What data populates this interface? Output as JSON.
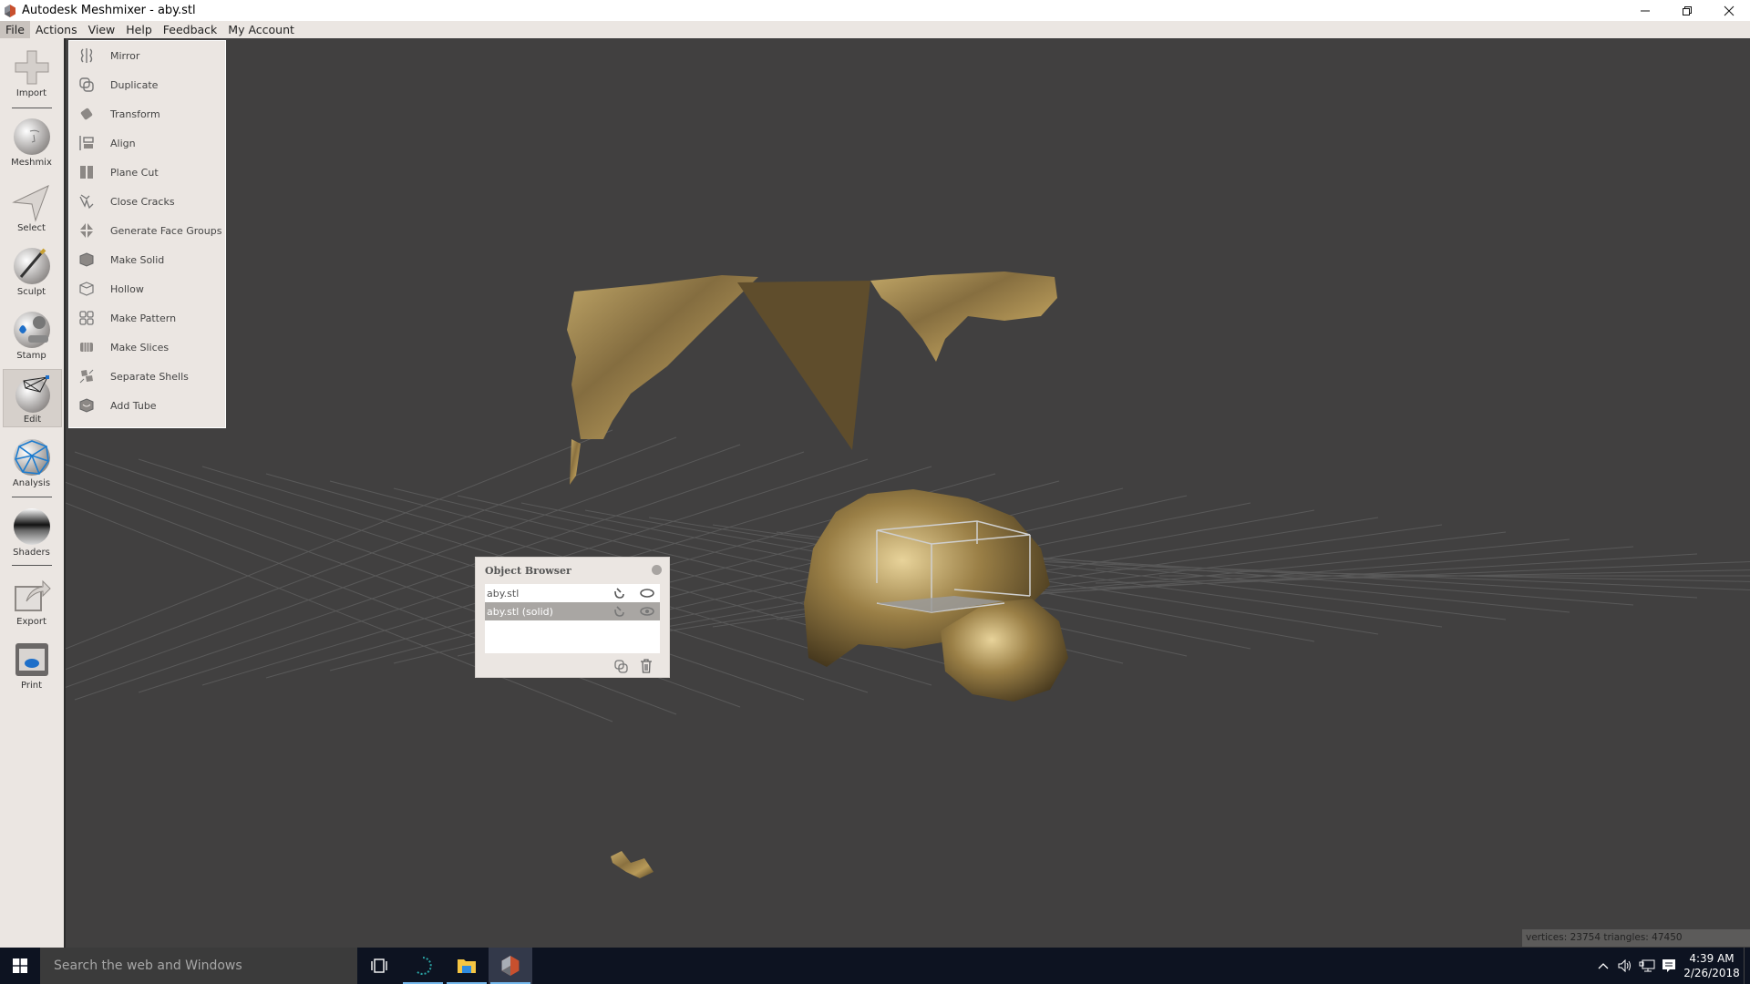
{
  "window": {
    "title": "Autodesk Meshmixer - aby.stl",
    "controls": {
      "minimize": "minimize-icon",
      "restore": "restore-icon",
      "close": "close-icon"
    }
  },
  "menubar": {
    "items": [
      {
        "label": "File",
        "active": true
      },
      {
        "label": "Actions"
      },
      {
        "label": "View"
      },
      {
        "label": "Help"
      },
      {
        "label": "Feedback"
      },
      {
        "label": "My Account"
      }
    ]
  },
  "sidebar": {
    "tools": [
      {
        "label": "Import",
        "icon": "plus-icon"
      },
      {
        "label": "Meshmix",
        "icon": "face-sphere-icon"
      },
      {
        "label": "Select",
        "icon": "arrow-cursor-icon"
      },
      {
        "label": "Sculpt",
        "icon": "brush-sphere-icon"
      },
      {
        "label": "Stamp",
        "icon": "stamp-icon"
      },
      {
        "label": "Edit",
        "icon": "mesh-sphere-icon",
        "active": true
      },
      {
        "label": "Analysis",
        "icon": "analysis-mesh-icon"
      },
      {
        "label": "Shaders",
        "icon": "chrome-sphere-icon"
      },
      {
        "label": "Export",
        "icon": "export-icon"
      },
      {
        "label": "Print",
        "icon": "printer-icon"
      }
    ]
  },
  "edit_menu": {
    "items": [
      {
        "label": "Mirror",
        "icon": "mirror-icon"
      },
      {
        "label": "Duplicate",
        "icon": "duplicate-icon"
      },
      {
        "label": "Transform",
        "icon": "transform-icon"
      },
      {
        "label": "Align",
        "icon": "align-icon"
      },
      {
        "label": "Plane Cut",
        "icon": "plane-cut-icon"
      },
      {
        "label": "Close Cracks",
        "icon": "close-cracks-icon"
      },
      {
        "label": "Generate Face Groups",
        "icon": "face-groups-icon"
      },
      {
        "label": "Make Solid",
        "icon": "make-solid-icon"
      },
      {
        "label": "Hollow",
        "icon": "hollow-icon"
      },
      {
        "label": "Make Pattern",
        "icon": "make-pattern-icon"
      },
      {
        "label": "Make Slices",
        "icon": "make-slices-icon"
      },
      {
        "label": "Separate Shells",
        "icon": "separate-shells-icon"
      },
      {
        "label": "Add Tube",
        "icon": "add-tube-icon"
      }
    ]
  },
  "object_browser": {
    "title": "Object Browser",
    "objects": [
      {
        "name": "aby.stl",
        "selected": false
      },
      {
        "name": "aby.stl (solid)",
        "selected": true
      }
    ]
  },
  "status": {
    "text": "vertices: 23754 triangles: 47450"
  },
  "taskbar": {
    "search_placeholder": "Search the web and Windows",
    "apps": [
      "task-view-icon",
      "app-swirl-icon",
      "file-explorer-icon",
      "meshmixer-icon"
    ],
    "time": "4:39 AM",
    "date": "2/26/2018"
  },
  "colors": {
    "viewport_bg": "#414040",
    "panel_bg": "#ebe6e2",
    "mesh_gold": "#8c7440",
    "taskbar_bg": "#0d1321"
  }
}
